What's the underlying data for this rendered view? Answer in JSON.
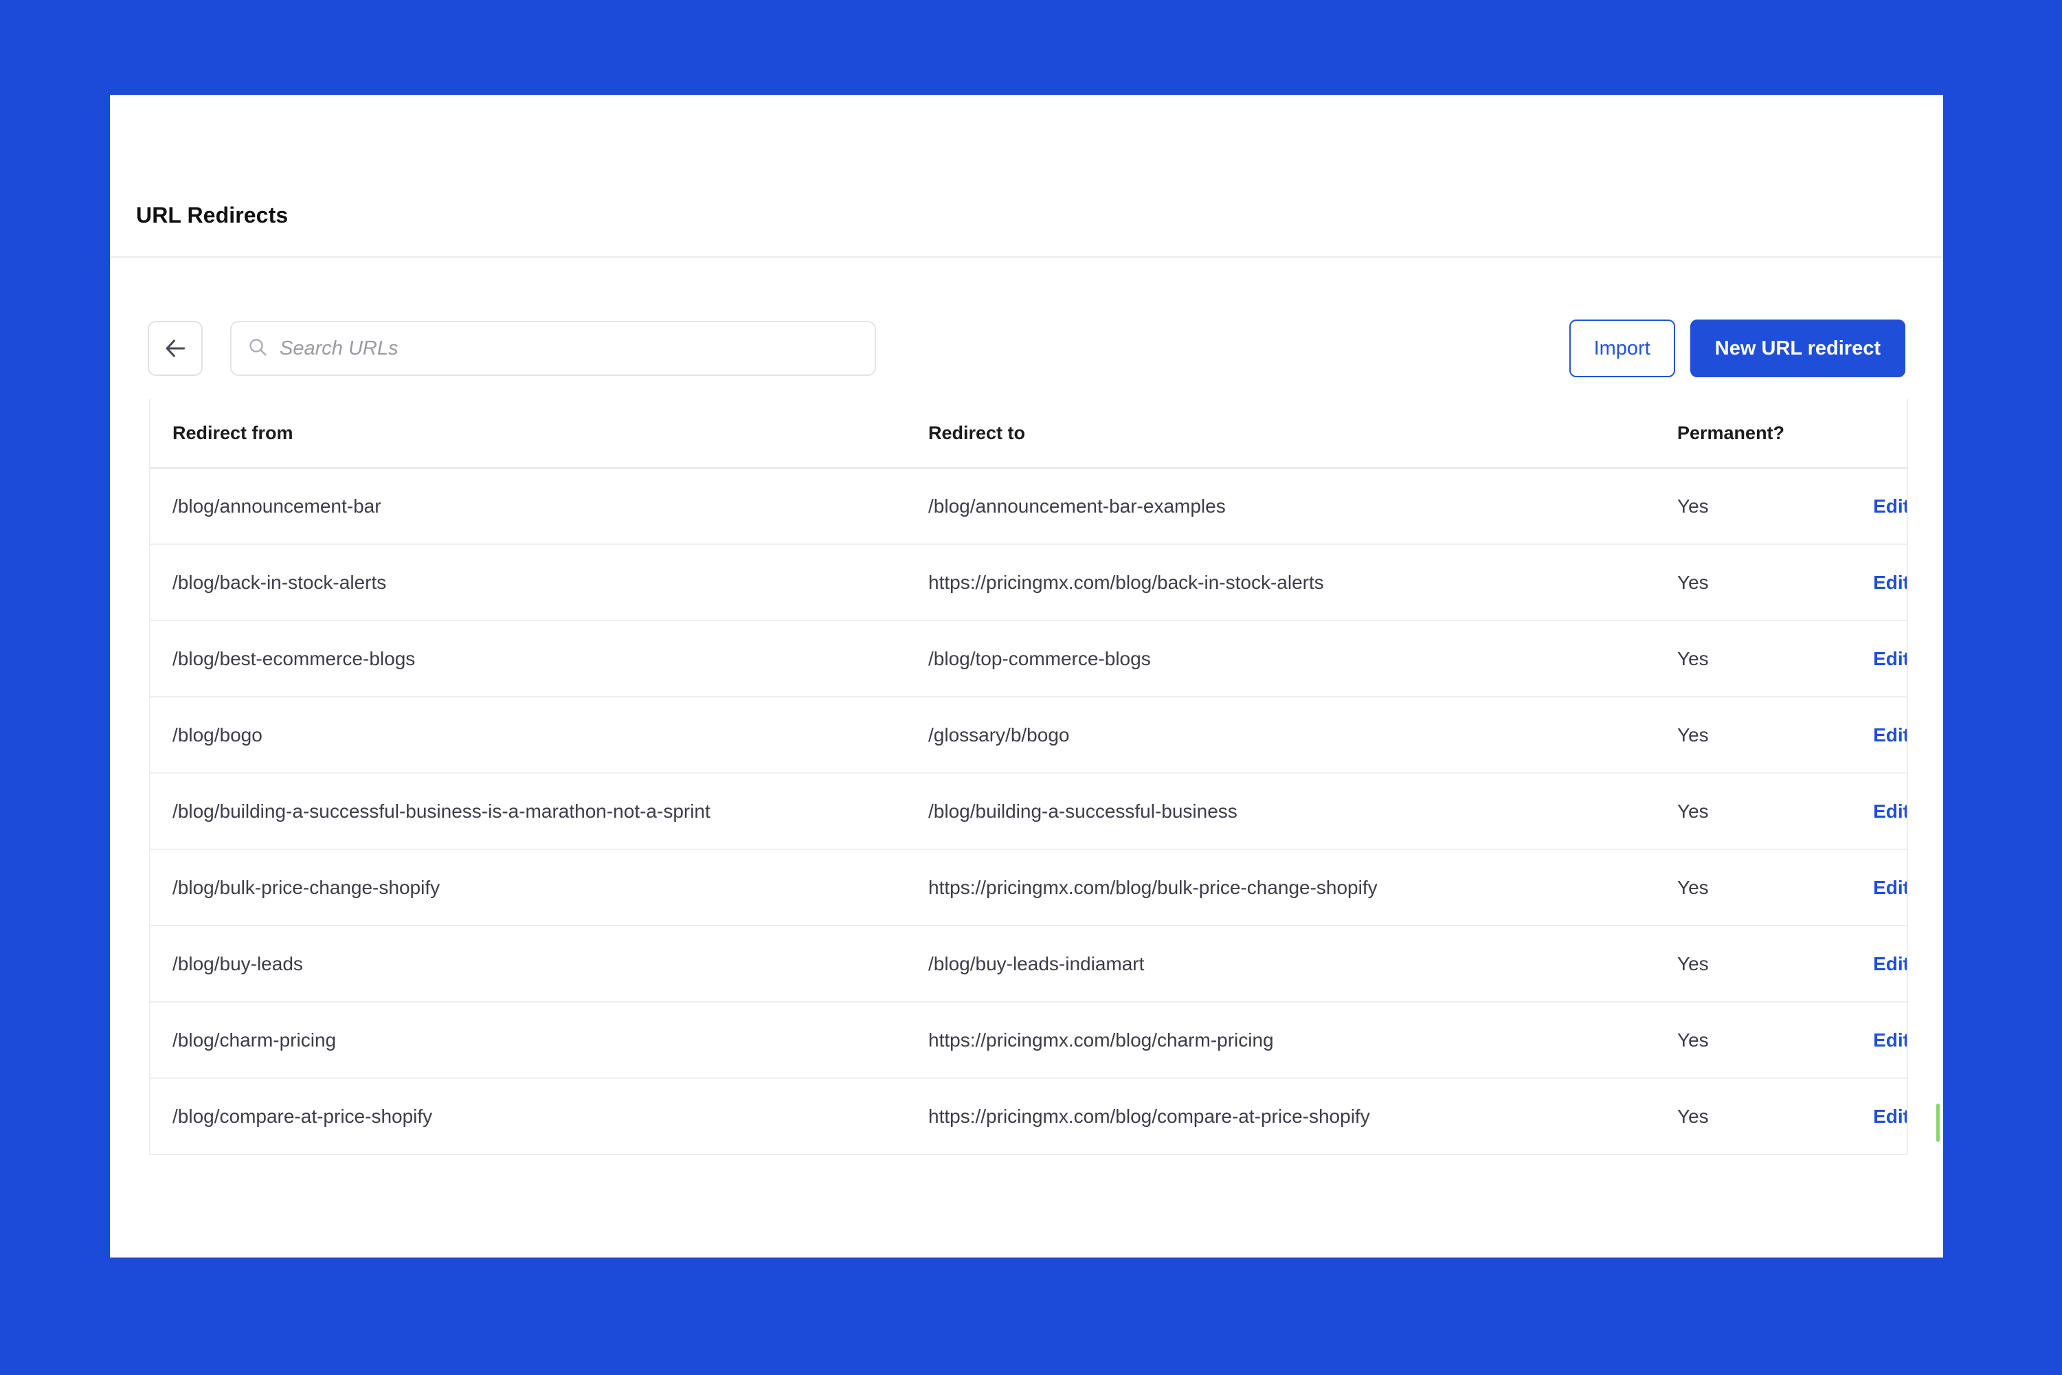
{
  "theme": {
    "background": "#1b4bd8",
    "panel_background": "#ffffff",
    "accent": "#1f4fd8",
    "link": "#1f4fd8",
    "border": "#ededed",
    "scroll_indicator": "#8fd66a"
  },
  "header": {
    "title": "URL Redirects"
  },
  "toolbar": {
    "back_icon": "arrow-left-icon",
    "search": {
      "icon": "search-icon",
      "value": "",
      "placeholder": "Search URLs"
    },
    "import_label": "Import",
    "new_redirect_label": "New URL redirect"
  },
  "table": {
    "columns": [
      "Redirect from",
      "Redirect to",
      "Permanent?",
      ""
    ],
    "row_action_label": "Edit",
    "rows": [
      {
        "from": "/blog/announcement-bar",
        "to": "/blog/announcement-bar-examples",
        "permanent": "Yes",
        "action": "Edit"
      },
      {
        "from": "/blog/back-in-stock-alerts",
        "to": "https://pricingmx.com/blog/back-in-stock-alerts",
        "permanent": "Yes",
        "action": "Edit"
      },
      {
        "from": "/blog/best-ecommerce-blogs",
        "to": "/blog/top-commerce-blogs",
        "permanent": "Yes",
        "action": "Edit"
      },
      {
        "from": "/blog/bogo",
        "to": "/glossary/b/bogo",
        "permanent": "Yes",
        "action": "Edit"
      },
      {
        "from": "/blog/building-a-successful-business-is-a-marathon-not-a-sprint",
        "to": "/blog/building-a-successful-business",
        "permanent": "Yes",
        "action": "Edit"
      },
      {
        "from": "/blog/bulk-price-change-shopify",
        "to": "https://pricingmx.com/blog/bulk-price-change-shopify",
        "permanent": "Yes",
        "action": "Edit"
      },
      {
        "from": "/blog/buy-leads",
        "to": "/blog/buy-leads-indiamart",
        "permanent": "Yes",
        "action": "Edit"
      },
      {
        "from": "/blog/charm-pricing",
        "to": "https://pricingmx.com/blog/charm-pricing",
        "permanent": "Yes",
        "action": "Edit"
      },
      {
        "from": "/blog/compare-at-price-shopify",
        "to": "https://pricingmx.com/blog/compare-at-price-shopify",
        "permanent": "Yes",
        "action": "Edit"
      }
    ]
  }
}
